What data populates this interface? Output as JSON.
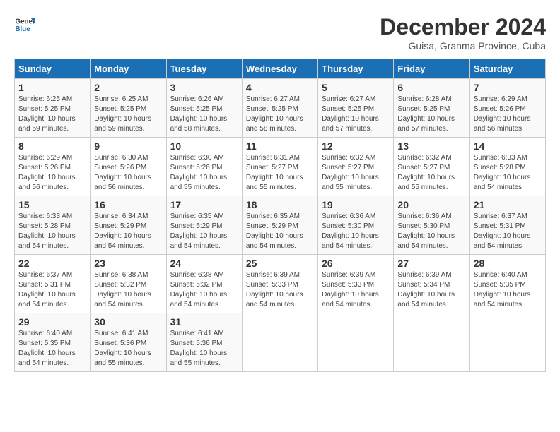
{
  "logo": {
    "line1": "General",
    "line2": "Blue"
  },
  "title": "December 2024",
  "subtitle": "Guisa, Granma Province, Cuba",
  "days": [
    "Sunday",
    "Monday",
    "Tuesday",
    "Wednesday",
    "Thursday",
    "Friday",
    "Saturday"
  ],
  "weeks": [
    [
      {
        "date": "1",
        "sunrise": "6:25 AM",
        "sunset": "5:25 PM",
        "daylight": "10 hours and 59 minutes."
      },
      {
        "date": "2",
        "sunrise": "6:25 AM",
        "sunset": "5:25 PM",
        "daylight": "10 hours and 59 minutes."
      },
      {
        "date": "3",
        "sunrise": "6:26 AM",
        "sunset": "5:25 PM",
        "daylight": "10 hours and 58 minutes."
      },
      {
        "date": "4",
        "sunrise": "6:27 AM",
        "sunset": "5:25 PM",
        "daylight": "10 hours and 58 minutes."
      },
      {
        "date": "5",
        "sunrise": "6:27 AM",
        "sunset": "5:25 PM",
        "daylight": "10 hours and 57 minutes."
      },
      {
        "date": "6",
        "sunrise": "6:28 AM",
        "sunset": "5:25 PM",
        "daylight": "10 hours and 57 minutes."
      },
      {
        "date": "7",
        "sunrise": "6:29 AM",
        "sunset": "5:26 PM",
        "daylight": "10 hours and 56 minutes."
      }
    ],
    [
      {
        "date": "8",
        "sunrise": "6:29 AM",
        "sunset": "5:26 PM",
        "daylight": "10 hours and 56 minutes."
      },
      {
        "date": "9",
        "sunrise": "6:30 AM",
        "sunset": "5:26 PM",
        "daylight": "10 hours and 56 minutes."
      },
      {
        "date": "10",
        "sunrise": "6:30 AM",
        "sunset": "5:26 PM",
        "daylight": "10 hours and 55 minutes."
      },
      {
        "date": "11",
        "sunrise": "6:31 AM",
        "sunset": "5:27 PM",
        "daylight": "10 hours and 55 minutes."
      },
      {
        "date": "12",
        "sunrise": "6:32 AM",
        "sunset": "5:27 PM",
        "daylight": "10 hours and 55 minutes."
      },
      {
        "date": "13",
        "sunrise": "6:32 AM",
        "sunset": "5:27 PM",
        "daylight": "10 hours and 55 minutes."
      },
      {
        "date": "14",
        "sunrise": "6:33 AM",
        "sunset": "5:28 PM",
        "daylight": "10 hours and 54 minutes."
      }
    ],
    [
      {
        "date": "15",
        "sunrise": "6:33 AM",
        "sunset": "5:28 PM",
        "daylight": "10 hours and 54 minutes."
      },
      {
        "date": "16",
        "sunrise": "6:34 AM",
        "sunset": "5:29 PM",
        "daylight": "10 hours and 54 minutes."
      },
      {
        "date": "17",
        "sunrise": "6:35 AM",
        "sunset": "5:29 PM",
        "daylight": "10 hours and 54 minutes."
      },
      {
        "date": "18",
        "sunrise": "6:35 AM",
        "sunset": "5:29 PM",
        "daylight": "10 hours and 54 minutes."
      },
      {
        "date": "19",
        "sunrise": "6:36 AM",
        "sunset": "5:30 PM",
        "daylight": "10 hours and 54 minutes."
      },
      {
        "date": "20",
        "sunrise": "6:36 AM",
        "sunset": "5:30 PM",
        "daylight": "10 hours and 54 minutes."
      },
      {
        "date": "21",
        "sunrise": "6:37 AM",
        "sunset": "5:31 PM",
        "daylight": "10 hours and 54 minutes."
      }
    ],
    [
      {
        "date": "22",
        "sunrise": "6:37 AM",
        "sunset": "5:31 PM",
        "daylight": "10 hours and 54 minutes."
      },
      {
        "date": "23",
        "sunrise": "6:38 AM",
        "sunset": "5:32 PM",
        "daylight": "10 hours and 54 minutes."
      },
      {
        "date": "24",
        "sunrise": "6:38 AM",
        "sunset": "5:32 PM",
        "daylight": "10 hours and 54 minutes."
      },
      {
        "date": "25",
        "sunrise": "6:39 AM",
        "sunset": "5:33 PM",
        "daylight": "10 hours and 54 minutes."
      },
      {
        "date": "26",
        "sunrise": "6:39 AM",
        "sunset": "5:33 PM",
        "daylight": "10 hours and 54 minutes."
      },
      {
        "date": "27",
        "sunrise": "6:39 AM",
        "sunset": "5:34 PM",
        "daylight": "10 hours and 54 minutes."
      },
      {
        "date": "28",
        "sunrise": "6:40 AM",
        "sunset": "5:35 PM",
        "daylight": "10 hours and 54 minutes."
      }
    ],
    [
      {
        "date": "29",
        "sunrise": "6:40 AM",
        "sunset": "5:35 PM",
        "daylight": "10 hours and 54 minutes."
      },
      {
        "date": "30",
        "sunrise": "6:41 AM",
        "sunset": "5:36 PM",
        "daylight": "10 hours and 55 minutes."
      },
      {
        "date": "31",
        "sunrise": "6:41 AM",
        "sunset": "5:36 PM",
        "daylight": "10 hours and 55 minutes."
      },
      null,
      null,
      null,
      null
    ]
  ]
}
